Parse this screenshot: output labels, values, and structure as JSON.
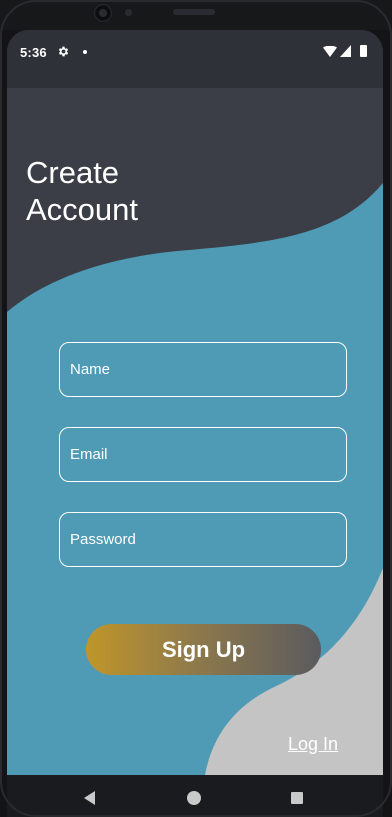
{
  "status_bar": {
    "time": "5:36",
    "icons": [
      "gear-icon",
      "notification-dot-icon",
      "wifi-icon",
      "signal-icon",
      "battery-icon"
    ]
  },
  "page": {
    "title": "Create\nAccount"
  },
  "form": {
    "name_placeholder": "Name",
    "email_placeholder": "Email",
    "password_placeholder": "Password"
  },
  "actions": {
    "signup_label": "Sign Up",
    "login_label": "Log In"
  },
  "nav": {
    "icons": [
      "back-icon",
      "home-icon",
      "recents-icon"
    ]
  },
  "colors": {
    "header_dark": "#3b3e46",
    "wave_blue": "#4f9ab5",
    "wave_light": "#c4c4c4",
    "button_gradient_start": "#c0962a",
    "button_gradient_end": "#5a5b5f",
    "text": "#ffffff"
  }
}
